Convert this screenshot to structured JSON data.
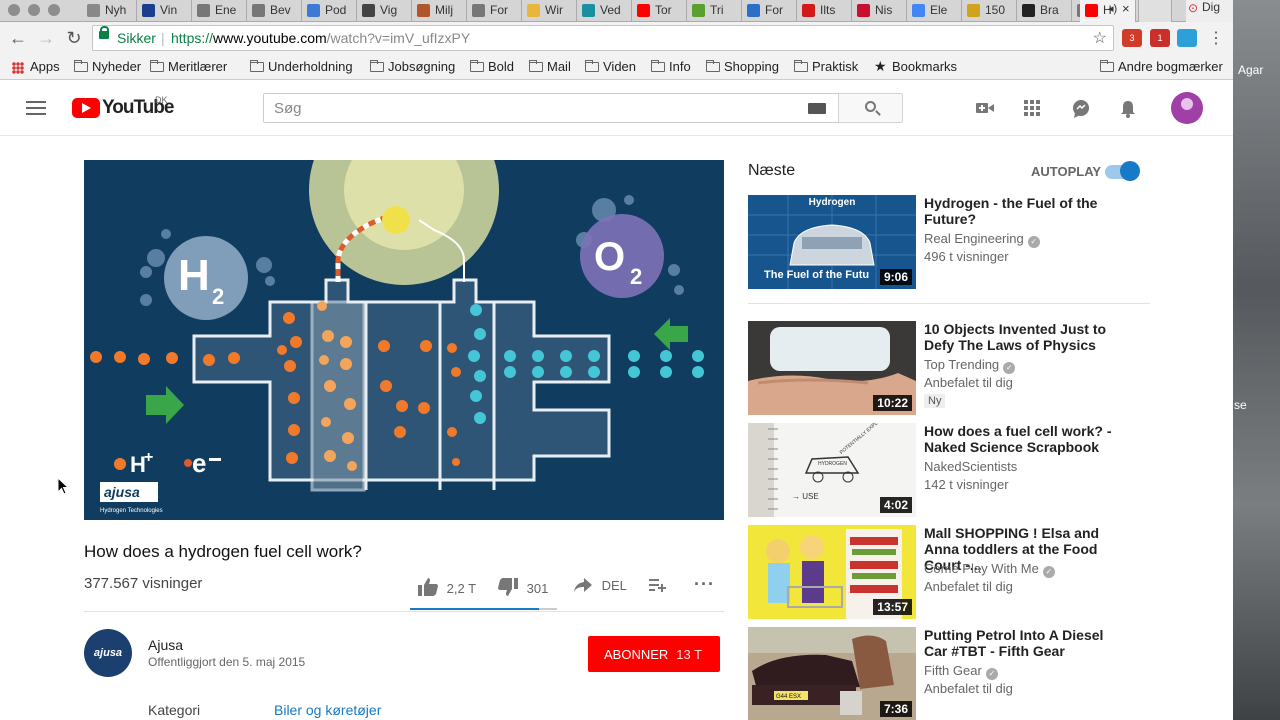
{
  "tabs": [
    {
      "label": "Nyh",
      "color": "#888"
    },
    {
      "label": "Vin",
      "color": "#1a3d8f"
    },
    {
      "label": "Ene",
      "color": "#777"
    },
    {
      "label": "Bev",
      "color": "#777"
    },
    {
      "label": "Pod",
      "color": "#3d7ad6"
    },
    {
      "label": "Vig",
      "color": "#444"
    },
    {
      "label": "Milj",
      "color": "#b0552c"
    },
    {
      "label": "For",
      "color": "#777"
    },
    {
      "label": "Wir",
      "color": "#e8b63a"
    },
    {
      "label": "Ved",
      "color": "#1a8fa0"
    },
    {
      "label": "Tor",
      "color": "#ff0000"
    },
    {
      "label": "Tri",
      "color": "#5aa02c"
    },
    {
      "label": "For",
      "color": "#2b6fc7"
    },
    {
      "label": "Ilts",
      "color": "#d21a1a"
    },
    {
      "label": "Nis",
      "color": "#c8102e"
    },
    {
      "label": "Ele",
      "color": "#4285f4"
    },
    {
      "label": "150",
      "color": "#d1a21e"
    },
    {
      "label": "Bra",
      "color": "#222"
    },
    {
      "label": "",
      "color": "#777"
    }
  ],
  "active_tab_label": "H",
  "corner_tab": "Dig",
  "address": {
    "secure": "Sikker",
    "url_scheme": "https://",
    "url_host": "www.youtube.com",
    "url_path": "/watch?v=imV_ufIzxPY"
  },
  "extensions": [
    {
      "label": "3",
      "color": "#d23a2a"
    },
    {
      "label": "1",
      "color": "#c9302c"
    },
    {
      "label": "",
      "color": "#2d9fd9"
    }
  ],
  "bookmarks": {
    "apps": "Apps",
    "items": [
      "Nyheder",
      "Meritlærer",
      "Underholdning",
      "Jobsøgning",
      "Bold",
      "Mail",
      "Viden",
      "Info",
      "Shopping",
      "Praktisk"
    ],
    "bookmarks_label": "Bookmarks",
    "other": "Andre bogmærker"
  },
  "desktop": {
    "label1": "Agar",
    "label2": "se"
  },
  "youtube": {
    "logo_text": "YouTube",
    "country": "DK",
    "search_placeholder": "Søg"
  },
  "video": {
    "title": "How does a hydrogen fuel cell work?",
    "views": "377.567 visninger",
    "likes": "2,2 T",
    "dislikes": "301",
    "share": "DEL",
    "like_ratio": 0.88,
    "overlay": {
      "h2": "H",
      "h2_sub": "2",
      "o2": "O",
      "o2_sub": "2",
      "hplus": "H",
      "eminus": "e",
      "brand": "ajusa",
      "brand_sub": "Hydrogen Technologies"
    }
  },
  "channel": {
    "name": "Ajusa",
    "logo_text": "ajusa",
    "published": "Offentliggjort den 5. maj 2015",
    "subscribe": "ABONNER",
    "subscribers": "13 T",
    "category_label": "Kategori",
    "category_value": "Biler og køretøjer"
  },
  "sidebar": {
    "next_label": "Næste",
    "autoplay_label": "AUTOPLAY",
    "autoplay_on": true,
    "videos": [
      {
        "title": "Hydrogen - the Fuel of the Future?",
        "channel": "Real Engineering",
        "meta": "496 t visninger",
        "duration": "9:06",
        "badge": "",
        "thumb_top": "Hydrogen",
        "thumb_bottom": "The Fuel of the Futu"
      },
      {
        "title": "10 Objects Invented Just to Defy The Laws of Physics",
        "channel": "Top Trending",
        "meta": "Anbefalet til dig",
        "duration": "10:22",
        "badge": "Ny"
      },
      {
        "title": "How does a fuel cell work? - Naked Science Scrapbook",
        "channel": "NakedScientists",
        "meta": "142 t visninger",
        "duration": "4:02",
        "badge": "",
        "thumb_top": "POTENTIALLY EXPLOSIVE!",
        "thumb_mid": "HYDROGEN",
        "thumb_bottom": "→ USE"
      },
      {
        "title": "Mall SHOPPING ! Elsa and Anna toddlers at the Food Court -...",
        "channel": "Come Play With Me",
        "meta": "Anbefalet til dig",
        "duration": "13:57",
        "badge": ""
      },
      {
        "title": "Putting Petrol Into A Diesel Car #TBT - Fifth Gear",
        "channel": "Fifth Gear",
        "meta": "Anbefalet til dig",
        "duration": "7:36",
        "badge": "",
        "thumb_bottom": "G44 ESX"
      }
    ]
  }
}
